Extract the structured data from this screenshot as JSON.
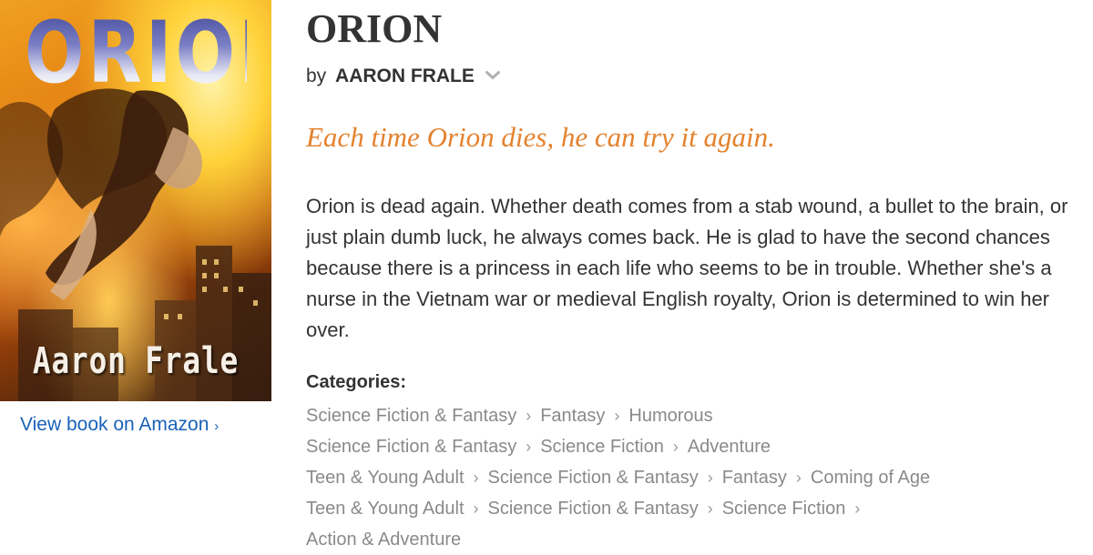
{
  "cover": {
    "title": "ORION",
    "author": "Aaron Frale"
  },
  "amazon_link": {
    "label": "View book on Amazon",
    "chevron": "›"
  },
  "book": {
    "title": "ORION",
    "by_prefix": "by",
    "author": "AARON FRALE",
    "tagline": "Each time Orion dies, he can try it again.",
    "description": "Orion is dead again. Whether death comes from a stab wound, a bullet to the brain, or just plain dumb luck, he always comes back. He is glad to have the second chances because there is a princess in each life who seems to be in trouble. Whether she's a nurse in the Vietnam war or medieval English royalty, Orion is determined to win her over."
  },
  "categories": {
    "label": "Categories:",
    "separator": "›",
    "lines": [
      [
        "Science Fiction & Fantasy",
        "Fantasy",
        "Humorous"
      ],
      [
        "Science Fiction & Fantasy",
        "Science Fiction",
        "Adventure"
      ],
      [
        "Teen & Young Adult",
        "Science Fiction & Fantasy",
        "Fantasy",
        "Coming of Age"
      ],
      [
        "Teen & Young Adult",
        "Science Fiction & Fantasy",
        "Science Fiction",
        ""
      ],
      [
        "Action & Adventure"
      ]
    ]
  },
  "colors": {
    "tagline": "#e4822e",
    "link": "#1a62b8",
    "category_text": "#8a8a8a",
    "body_text": "#333333"
  },
  "icons": {
    "author_dropdown": "chevron-down-icon",
    "link_arrow": "chevron-right-icon"
  }
}
